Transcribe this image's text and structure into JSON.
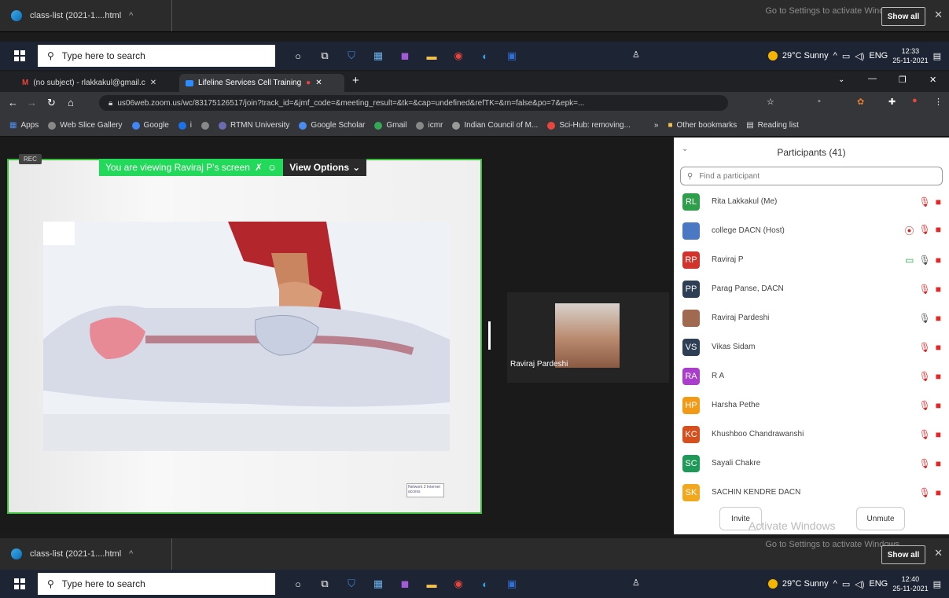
{
  "download_bar_top": {
    "file": "class-list (2021-1....html",
    "activate_text": "Go to Settings to activate Windows.",
    "show_all": "Show all"
  },
  "taskbar_top": {
    "search_placeholder": "Type here to search",
    "weather": "29°C  Sunny",
    "lang": "ENG",
    "time": "12:33",
    "date": "25-11-2021"
  },
  "browser": {
    "tabs": [
      {
        "label": "(no subject) - rlakkakul@gmail.c"
      },
      {
        "label": "Lifeline Services Cell Training"
      }
    ],
    "url": "us06web.zoom.us/wc/83175126517/join?track_id=&jmf_code=&meeting_result=&tk=&cap=undefined&refTK=&rn=false&po=7&epk=...",
    "bookmarks": [
      "Apps",
      "Web Slice Gallery",
      "Google",
      "i",
      "",
      "RTMN University",
      "Google Scholar",
      "Gmail",
      "icmr",
      "Indian Council of M...",
      "Sci-Hub: removing..."
    ],
    "other_bookmarks": "Other bookmarks",
    "reading_list": "Reading list"
  },
  "zoom": {
    "rec": "REC",
    "viewing": "You are viewing Raviraj P's screen",
    "view_options": "View Options",
    "slide_tag": "Network 2\nInternet access",
    "video_name": "Raviraj Pardeshi"
  },
  "participants": {
    "title": "Participants (41)",
    "search_placeholder": "Find a participant",
    "list": [
      {
        "initials": "RL",
        "name": "Rita Lakkakul (Me)",
        "color": "#2e9e4a",
        "mic": "off",
        "share": false,
        "record": false
      },
      {
        "initials": "",
        "name": "college DACN (Host)",
        "color": "#4a78c2",
        "mic": "off",
        "share": false,
        "record": true
      },
      {
        "initials": "RP",
        "name": "Raviraj P",
        "color": "#d0342c",
        "mic": "on",
        "share": true,
        "record": false
      },
      {
        "initials": "PP",
        "name": "Parag Panse, DACN",
        "color": "#2d3e55",
        "mic": "off",
        "share": false,
        "record": false
      },
      {
        "initials": "",
        "name": "Raviraj Pardeshi",
        "color": "#a06a50",
        "mic": "on",
        "share": false,
        "record": false
      },
      {
        "initials": "VS",
        "name": "Vikas Sidam",
        "color": "#2d3e55",
        "mic": "off",
        "share": false,
        "record": false
      },
      {
        "initials": "RA",
        "name": "R A",
        "color": "#a83ec9",
        "mic": "off",
        "share": false,
        "record": false
      },
      {
        "initials": "HP",
        "name": "Harsha Pethe",
        "color": "#f29a16",
        "mic": "off",
        "share": false,
        "record": false
      },
      {
        "initials": "KC",
        "name": "Khushboo Chandrawanshi",
        "color": "#d4501e",
        "mic": "off",
        "share": false,
        "record": false
      },
      {
        "initials": "SC",
        "name": "Sayali Chakre",
        "color": "#1e9a58",
        "mic": "off",
        "share": false,
        "record": false
      },
      {
        "initials": "SK",
        "name": "SACHIN KENDRE DACN",
        "color": "#f2a81e",
        "mic": "off",
        "share": false,
        "record": false
      }
    ],
    "invite": "Invite",
    "unmute": "Unmute",
    "watermark": "Activate Windows"
  },
  "download_bar_bottom": {
    "file": "class-list (2021-1....html",
    "activate_text": "Go to Settings to activate Windows.",
    "show_all": "Show all"
  },
  "taskbar_bottom": {
    "search_placeholder": "Type here to search",
    "weather": "29°C  Sunny",
    "lang": "ENG",
    "time": "12:40",
    "date": "25-11-2021"
  }
}
